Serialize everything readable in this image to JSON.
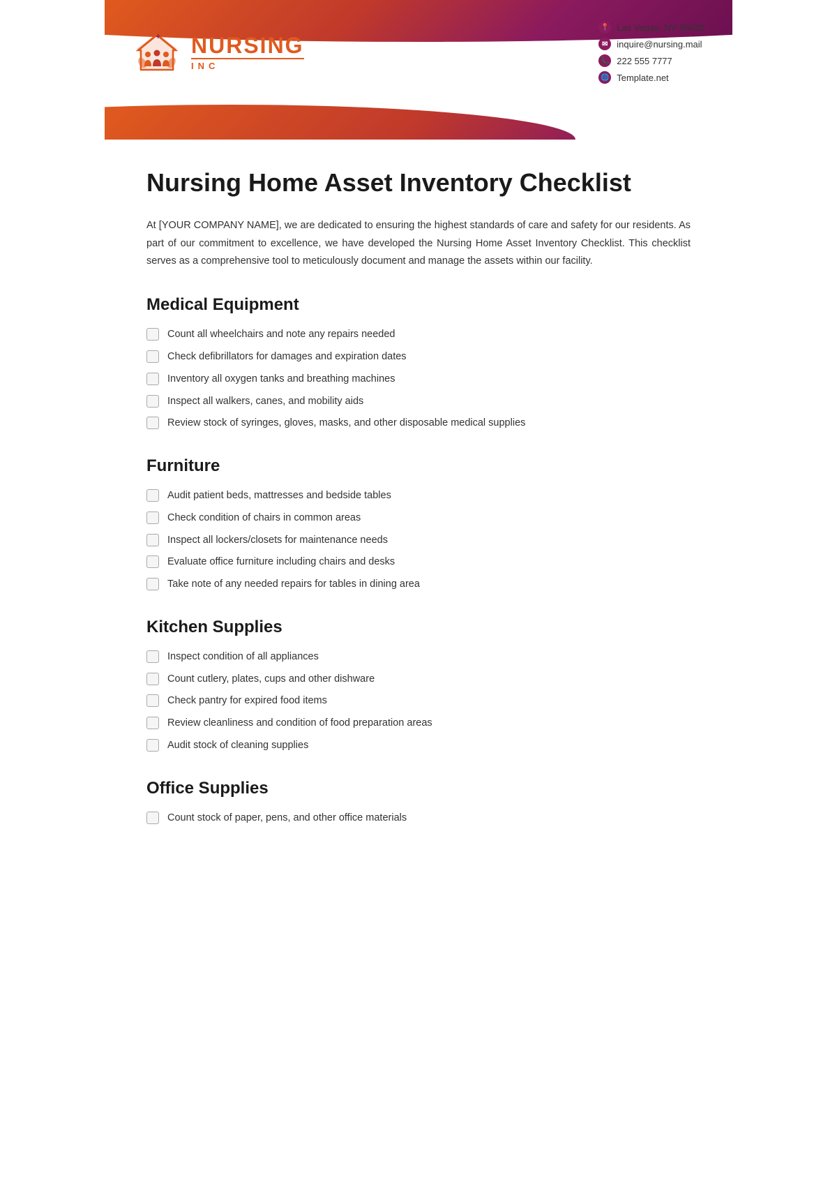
{
  "header": {
    "logo": {
      "name": "NURSING",
      "inc": "INC"
    },
    "contact": {
      "address": "Las Vegas, NV 89030",
      "email": "inquire@nursing.mail",
      "phone": "222 555 7777",
      "website": "Template.net"
    }
  },
  "page": {
    "title": "Nursing Home Asset Inventory Checklist",
    "intro": "At [YOUR COMPANY NAME], we are dedicated to ensuring the highest standards of care and safety for our residents. As part of our commitment to excellence, we have developed the Nursing Home Asset Inventory Checklist. This checklist serves as a comprehensive tool to meticulously document and manage the assets within our facility."
  },
  "sections": [
    {
      "id": "medical-equipment",
      "title": "Medical Equipment",
      "items": [
        "Count all wheelchairs and note any repairs needed",
        "Check defibrillators for damages and expiration dates",
        "Inventory all oxygen tanks and breathing machines",
        "Inspect all walkers, canes, and mobility aids",
        "Review stock of syringes, gloves, masks, and other disposable medical supplies"
      ]
    },
    {
      "id": "furniture",
      "title": "Furniture",
      "items": [
        "Audit patient beds, mattresses and bedside tables",
        "Check condition of chairs in common areas",
        "Inspect all lockers/closets for maintenance needs",
        "Evaluate office furniture including chairs and desks",
        "Take note of any needed repairs for tables in dining area"
      ]
    },
    {
      "id": "kitchen-supplies",
      "title": "Kitchen Supplies",
      "items": [
        "Inspect condition of all appliances",
        "Count cutlery, plates, cups and other dishware",
        "Check pantry for expired food items",
        "Review cleanliness and condition of food preparation areas",
        "Audit stock of cleaning supplies"
      ]
    },
    {
      "id": "office-supplies",
      "title": "Office Supplies",
      "items": [
        "Count stock of paper, pens, and other office materials"
      ]
    }
  ]
}
